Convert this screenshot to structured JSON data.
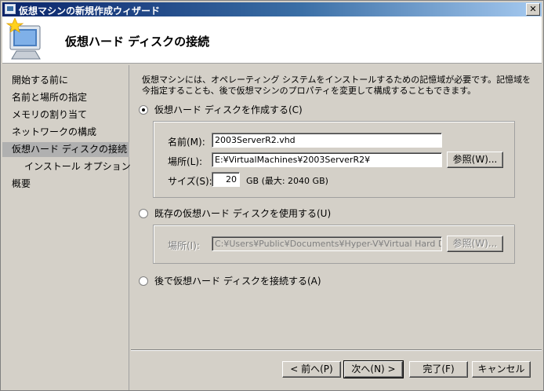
{
  "window": {
    "title": "仮想マシンの新規作成ウィザード",
    "close_label": "✕"
  },
  "header": {
    "title": "仮想ハード ディスクの接続"
  },
  "sidebar": {
    "items": [
      {
        "label": "開始する前に"
      },
      {
        "label": "名前と場所の指定"
      },
      {
        "label": "メモリの割り当て"
      },
      {
        "label": "ネットワークの構成"
      },
      {
        "label": "仮想ハード ディスクの接続",
        "active": true
      },
      {
        "label": "インストール オプション"
      },
      {
        "label": "概要"
      }
    ]
  },
  "main": {
    "intro": "仮想マシンには、オペレーティング システムをインストールするための記憶域が必要です。記憶域を今指定することも、後で仮想マシンのプロパティを変更して構成することもできます。",
    "option_create": {
      "label": "仮想ハード ディスクを作成する(C)",
      "checked": true,
      "name_label": "名前(M):",
      "name_value": "2003ServerR2.vhd",
      "location_label": "場所(L):",
      "location_value": "E:¥VirtualMachines¥2003ServerR2¥",
      "browse_label": "参照(W)...",
      "size_label": "サイズ(S):",
      "size_value": "20",
      "size_unit": "GB (最大: 2040 GB)"
    },
    "option_existing": {
      "label": "既存の仮想ハード ディスクを使用する(U)",
      "checked": false,
      "location_label": "場所(I):",
      "location_value": "C:¥Users¥Public¥Documents¥Hyper-V¥Virtual Hard Disks¥",
      "browse_label": "参照(W)..."
    },
    "option_later": {
      "label": "後で仮想ハード ディスクを接続する(A)",
      "checked": false
    }
  },
  "footer": {
    "prev_label": "< 前へ(P)",
    "next_label": "次へ(N) >",
    "finish_label": "完了(F)",
    "cancel_label": "キャンセル"
  }
}
